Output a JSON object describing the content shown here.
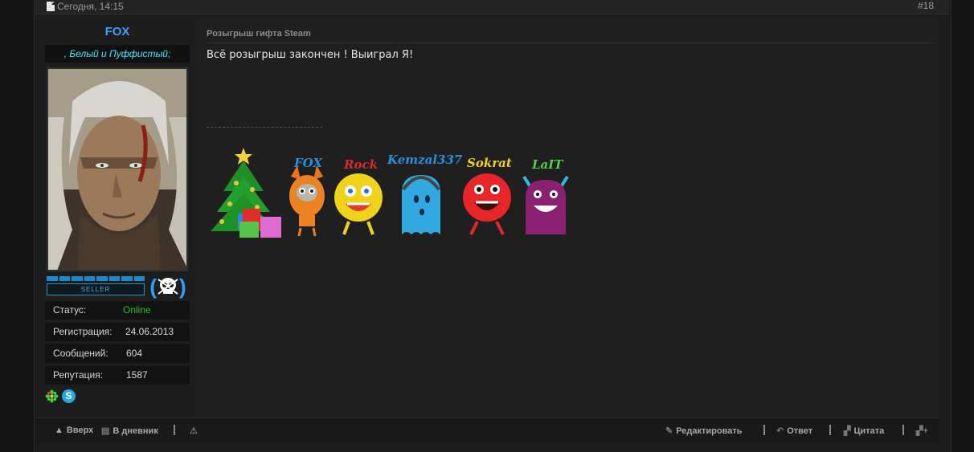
{
  "post": {
    "date": "Сегодня, 14:15",
    "number": "#18",
    "title": "Розыгрыш гифта Steam",
    "text": "Всё розыгрыш закончен ! Выиграл Я!"
  },
  "user": {
    "name": "FOX",
    "title": ", Белый и Пуффистый;",
    "rank_label": "SELLER",
    "stats": [
      {
        "key": "Статус:",
        "value": "Online"
      },
      {
        "key": "Регистрация:",
        "value": "24.06.2013"
      },
      {
        "key": "Сообщений:",
        "value": "604"
      },
      {
        "key": "Репутация:",
        "value": "1587"
      }
    ],
    "colors": {
      "name": "#3aa0ff",
      "online": "#1fc41f",
      "title": "#48e8ff"
    }
  },
  "signature": {
    "monsters": [
      "FOX",
      "Rock",
      "Kemzal337",
      "Sokrat",
      "LaIT"
    ]
  },
  "actions": {
    "up": "Вверх",
    "diary": "В дневник",
    "edit": "Редактировать",
    "reply": "Ответ",
    "quote": "Цитата"
  }
}
